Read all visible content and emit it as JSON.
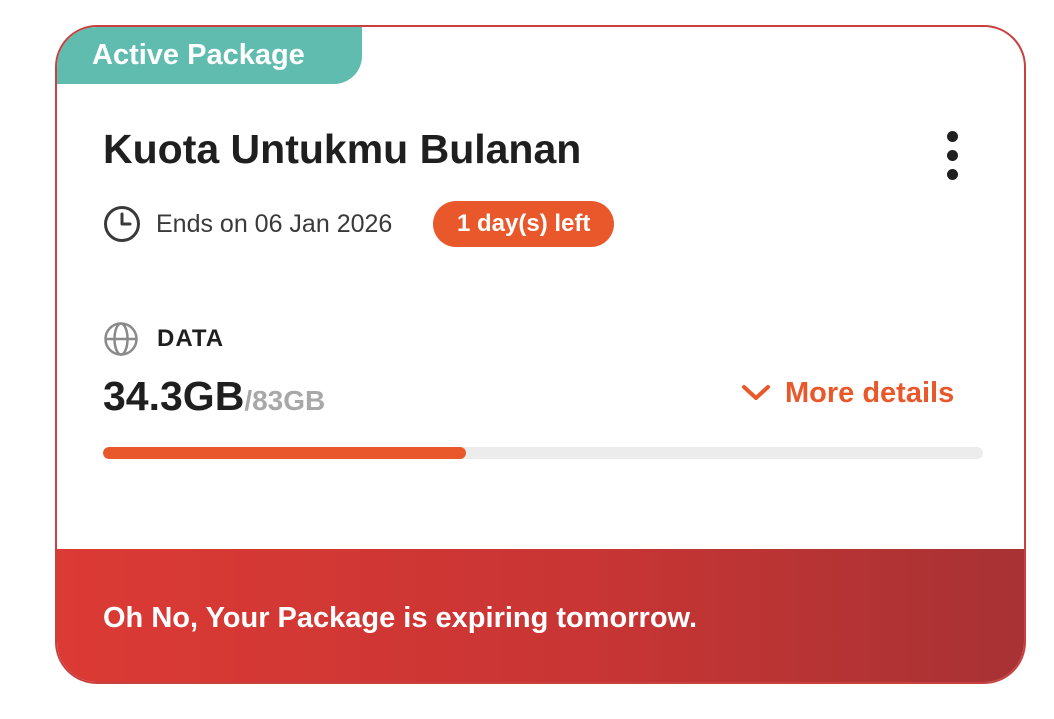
{
  "card": {
    "tag_label": "Active Package",
    "title": "Kuota Untukmu Bulanan",
    "menu_icon": "kebab-menu-icon",
    "expiry": {
      "icon": "clock-icon",
      "ends_text": "Ends on 06 Jan 2026",
      "days_left_badge": "1 day(s) left"
    },
    "data": {
      "icon": "globe-icon",
      "label": "DATA",
      "used": "34.3GB",
      "total": "/83GB",
      "progress_fraction": 0.413,
      "more_details_label": "More details",
      "more_details_icon": "chevron-down-icon"
    },
    "warning_message": "Oh No, Your Package is expiring tomorrow."
  },
  "colors": {
    "tag_bg": "#5fbcae",
    "accent_orange": "#e8582a",
    "warning_red": "#d23a34",
    "border": "#c84040"
  }
}
